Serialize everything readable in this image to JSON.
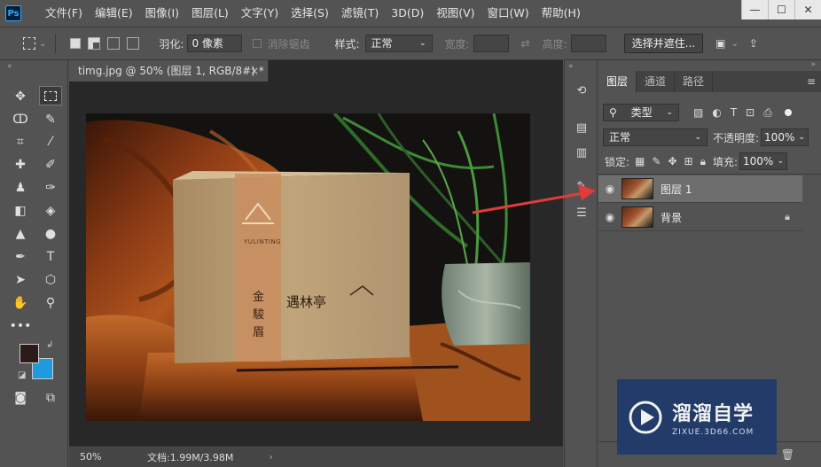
{
  "app": {
    "logo": "Ps"
  },
  "menu": {
    "items": [
      "文件(F)",
      "编辑(E)",
      "图像(I)",
      "图层(L)",
      "文字(Y)",
      "选择(S)",
      "滤镜(T)",
      "3D(D)",
      "视图(V)",
      "窗口(W)",
      "帮助(H)"
    ]
  },
  "window_buttons": {
    "minimize": "—",
    "maximize": "☐",
    "close": "✕"
  },
  "options": {
    "feather_label": "羽化:",
    "feather_value": "0 像素",
    "antialias_label": "消除锯齿",
    "style_label": "样式:",
    "style_value": "正常",
    "width_label": "宽度:",
    "height_label": "高度:",
    "select_mask_label": "选择并遮住..."
  },
  "document": {
    "tab_title": "timg.jpg @ 50% (图层 1, RGB/8#) *",
    "close": "×",
    "zoom": "50%",
    "doc_size": "文档:1.99M/3.98M",
    "status_arrow": "›"
  },
  "product": {
    "brand_en": "YULINTING",
    "vertical_text": [
      "金",
      "駿",
      "眉"
    ],
    "brand_cn": "遇林亭"
  },
  "layers_panel": {
    "tabs": [
      "图层",
      "通道",
      "路径"
    ],
    "filter_kind": "类型",
    "blend_mode": "正常",
    "opacity_label": "不透明度:",
    "opacity_value": "100%",
    "lock_label": "锁定:",
    "fill_label": "填充:",
    "fill_value": "100%",
    "layers": [
      {
        "name": "图层 1",
        "selected": true
      },
      {
        "name": "背景",
        "selected": false
      }
    ]
  },
  "watermark": {
    "title": "溜溜自学",
    "url": "ZIXUE.3D66.COM"
  },
  "colors": {
    "accent": "#31a8ff",
    "foreground": "#2a1a18",
    "background": "#1e9be0",
    "arrow": "#e23b3b"
  }
}
